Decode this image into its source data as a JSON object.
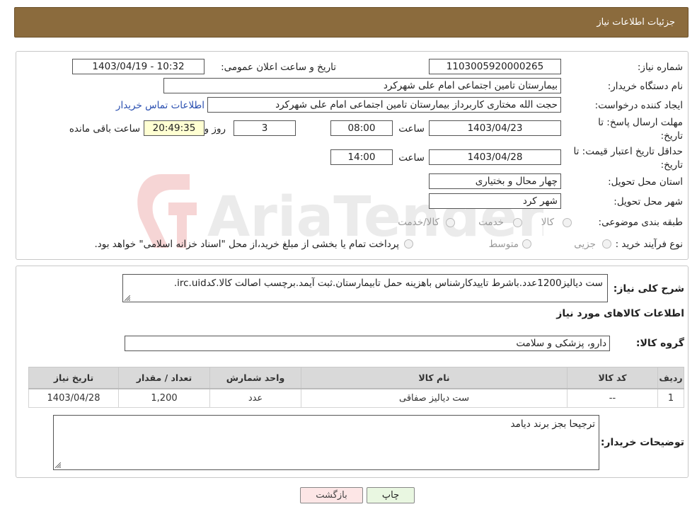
{
  "header": {
    "title": "جزئیات اطلاعات نیاز"
  },
  "fields": {
    "need_number_label": "شماره نیاز:",
    "need_number": "1103005920000265",
    "announce_label": "تاریخ و ساعت اعلان عمومی:",
    "announce_value": "1403/04/19 - 10:32",
    "buyer_org_label": "نام دستگاه خریدار:",
    "buyer_org": "بیمارستان تامین اجتماعی امام علی شهرکرد",
    "creator_label": "ایجاد کننده درخواست:",
    "creator": "حجت الله مختاری کاربرداز بیمارستان تامین اجتماعی امام علی شهرکرد",
    "contact_link": "اطلاعات تماس خریدار",
    "reply_deadline_label": "مهلت ارسال پاسخ: تا تاریخ:",
    "reply_date": "1403/04/23",
    "time_label": "ساعت",
    "reply_time": "08:00",
    "days_value": "3",
    "days_label": "روز و",
    "remaining_time": "20:49:35",
    "remaining_label": "ساعت باقی مانده",
    "price_validity_label": "حداقل تاریخ اعتبار قیمت: تا تاریخ:",
    "price_date": "1403/04/28",
    "price_time": "14:00",
    "province_label": "استان محل تحویل:",
    "province": "چهار محال و بختیاری",
    "city_label": "شهر محل تحویل:",
    "city": "شهر کرد",
    "category_label": "طبقه بندی موضوعی:",
    "category_options": [
      "کالا",
      "خدمت",
      "کالا/خدمت"
    ],
    "process_label": "نوع فرآیند خرید :",
    "process_options": [
      "جزیی",
      "متوسط"
    ],
    "process_note": "پرداخت تمام یا بخشی از مبلغ خرید،از محل \"اسناد خزانه اسلامی\" خواهد بود."
  },
  "description": {
    "label": "شرح کلی نیاز:",
    "text": "ست دیالیز1200عدد.باشرط تاییدکارشناس باهزینه حمل تابیمارستان.ثبت آیمد.برچسب اصالت کالا.کدirc.uid."
  },
  "goods_info_title": "اطلاعات کالاهای مورد نیاز",
  "goods_group": {
    "label": "گروه کالا:",
    "value": "دارو، پزشکی و سلامت"
  },
  "table": {
    "headers": [
      "ردیف",
      "کد کالا",
      "نام کالا",
      "واحد شمارش",
      "تعداد / مقدار",
      "تاریخ نیاز"
    ],
    "rows": [
      [
        "1",
        "--",
        "ست دیالیز صفاقی",
        "عدد",
        "1,200",
        "1403/04/28"
      ]
    ]
  },
  "buyer_notes": {
    "label": "توضیحات خریدار:",
    "text": "ترجیحا بجز برند دیامد"
  },
  "buttons": {
    "print": "چاپ",
    "back": "بازگشت"
  },
  "watermark": {
    "text": "AriaTender.neT"
  },
  "colors": {
    "header_bg": "#8b6b3d",
    "link": "#2a4fb0",
    "back_button_bg": "#fde6e6",
    "print_button_bg": "#e9f7e1",
    "remaining_bg": "#ffffd2"
  }
}
